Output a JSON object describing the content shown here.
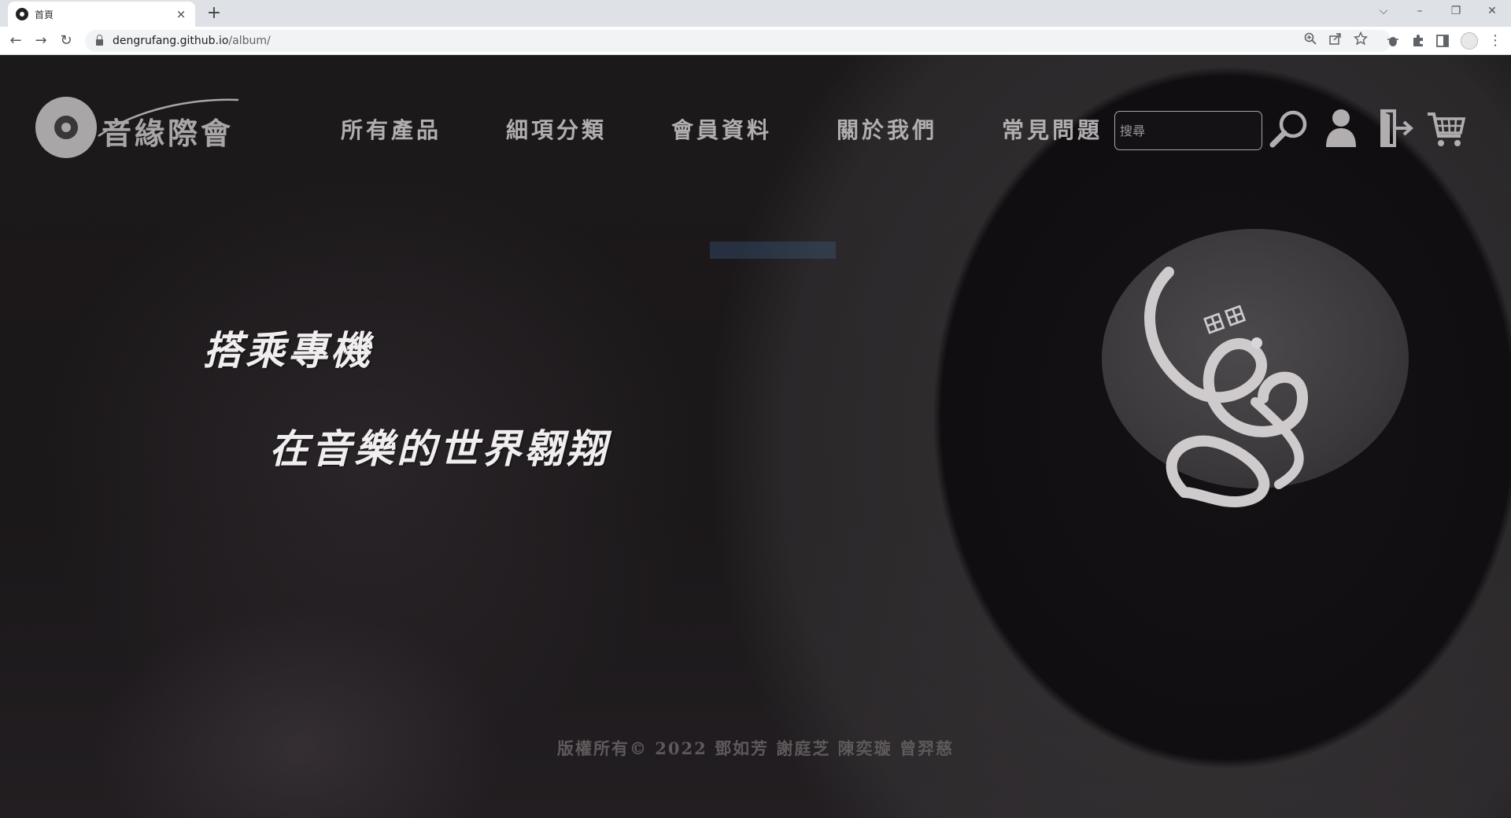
{
  "browser": {
    "tab_title": "首頁",
    "tab_close": "×",
    "new_tab": "+",
    "url_host": "dengrufang.github.io",
    "url_path": "/album/",
    "window_controls": {
      "dropdown": "⌵",
      "minimize": "–",
      "restore": "❐",
      "close": "✕"
    },
    "nav": {
      "back": "←",
      "forward": "→",
      "reload": "↻"
    }
  },
  "site": {
    "logo_text": "音緣際會",
    "nav_items": [
      "所有產品",
      "細項分類",
      "會員資料",
      "關於我們",
      "常見問題"
    ],
    "search_placeholder": "搜尋",
    "hero_line1": "搭乘專機",
    "hero_line2": "在音樂的世界翱翔",
    "footer": "版權所有© 2022 鄧如芳 謝庭芝 陳奕璇 曾羿慈"
  },
  "colors": {
    "page_bg": "#1a1718",
    "nav_text": "#b2aeb0",
    "hero_text": "#f0eeef",
    "footer_text": "#5e5a5c",
    "icon": "#b2aeb0"
  },
  "icons": [
    "search-icon",
    "user-icon",
    "logout-icon",
    "cart-icon"
  ]
}
